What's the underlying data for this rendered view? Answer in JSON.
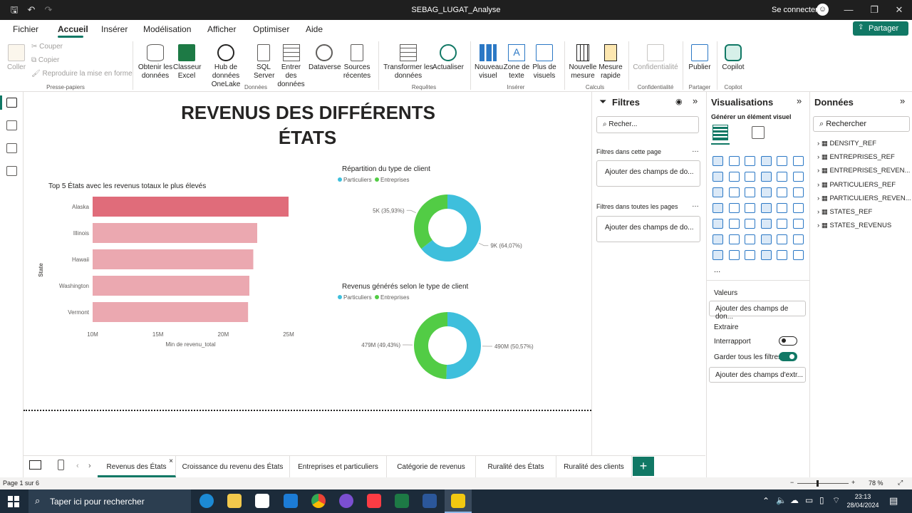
{
  "window": {
    "title": "SEBAG_LUGAT_Analyse",
    "signin": "Se connecter"
  },
  "menu": {
    "items": [
      "Fichier",
      "Accueil",
      "Insérer",
      "Modélisation",
      "Afficher",
      "Optimiser",
      "Aide"
    ],
    "active": "Accueil",
    "share": "Partager"
  },
  "ribbon": {
    "clipboard": {
      "paste": "Coller",
      "cut": "Couper",
      "copy": "Copier",
      "format": "Reproduire la mise en forme",
      "group": "Presse-papiers"
    },
    "data": {
      "get": "Obtenir les données",
      "excel": "Classeur Excel",
      "onelake": "Hub de données OneLake",
      "sql": "SQL Server",
      "enter": "Entrer des données",
      "dataverse": "Dataverse",
      "recent": "Sources récentes",
      "group": "Données"
    },
    "queries": {
      "transform": "Transformer les données",
      "refresh": "Actualiser",
      "group": "Requêtes"
    },
    "insert": {
      "new_visual": "Nouveau visuel",
      "textbox": "Zone de texte",
      "more": "Plus de visuels",
      "group": "Insérer"
    },
    "calc": {
      "measure": "Nouvelle mesure",
      "quick": "Mesure rapide",
      "group": "Calculs"
    },
    "confidentiality": {
      "label": "Confidentialité",
      "group": "Confidentialité"
    },
    "share": {
      "publish": "Publier",
      "group": "Partager"
    },
    "copilot": {
      "label": "Copilot",
      "group": "Copilot"
    }
  },
  "report": {
    "title_line1": "REVENUS DES DIFFÉRENTS",
    "title_line2": "ÉTATS"
  },
  "chart_data": [
    {
      "type": "bar",
      "title": "Top 5 États avec les revenus totaux le plus élevés",
      "xlabel": "Min de revenu_total",
      "ylabel": "State",
      "categories": [
        "Alaska",
        "Illinois",
        "Hawaii",
        "Washington",
        "Vermont"
      ],
      "values": [
        25000000,
        22600000,
        22300000,
        22000000,
        21900000
      ],
      "xlim": [
        10000000,
        25000000
      ],
      "xticks": [
        "10M",
        "15M",
        "20M",
        "25M"
      ],
      "colors": [
        "#e06c7a",
        "#eba8b0",
        "#eba8b0",
        "#eba8b0",
        "#eba8b0"
      ]
    },
    {
      "type": "pie",
      "title": "Répartition du type de client",
      "legend": [
        "Particuliers",
        "Entreprises"
      ],
      "colors": [
        "#3ebfdc",
        "#52cc45"
      ],
      "values": [
        9000,
        5000
      ],
      "labels": [
        "9K (64,07%)",
        "5K (35,93%)"
      ]
    },
    {
      "type": "pie",
      "title": "Revenus générés selon le type de client",
      "legend": [
        "Particuliers",
        "Entreprises"
      ],
      "colors": [
        "#3ebfdc",
        "#52cc45"
      ],
      "values": [
        490000000,
        479000000
      ],
      "labels": [
        "490M (50,57%)",
        "479M (49,43%)"
      ]
    }
  ],
  "filters": {
    "title": "Filtres",
    "search": "Recher...",
    "this_page": "Filtres dans cette page",
    "all_pages": "Filtres dans toutes les pages",
    "add": "Ajouter des champs de do..."
  },
  "visualizations": {
    "title": "Visualisations",
    "build": "Générer un élément visuel",
    "values": "Valeurs",
    "add_values": "Ajouter des champs de don...",
    "drill": "Extraire",
    "cross": "Interrapport",
    "keep": "Garder tous les filtres",
    "add_drill": "Ajouter des champs d'extr...",
    "more": "..."
  },
  "data_pane": {
    "title": "Données",
    "search": "Rechercher",
    "tables": [
      "DENSITY_REF",
      "ENTREPRISES_REF",
      "ENTREPRISES_REVEN...",
      "PARTICULIERS_REF",
      "PARTICULIERS_REVEN...",
      "STATES_REF",
      "STATES_REVENUS"
    ]
  },
  "tabs": [
    "Revenus des États",
    "Croissance du revenu des États",
    "Entreprises et particuliers",
    "Catégorie de revenus",
    "Ruralité des États",
    "Ruralité des clients"
  ],
  "status": {
    "page": "Page 1 sur 6",
    "zoom": "78 %"
  },
  "taskbar": {
    "search": "Taper ici pour rechercher",
    "time": "23:13",
    "date": "28/04/2024"
  }
}
